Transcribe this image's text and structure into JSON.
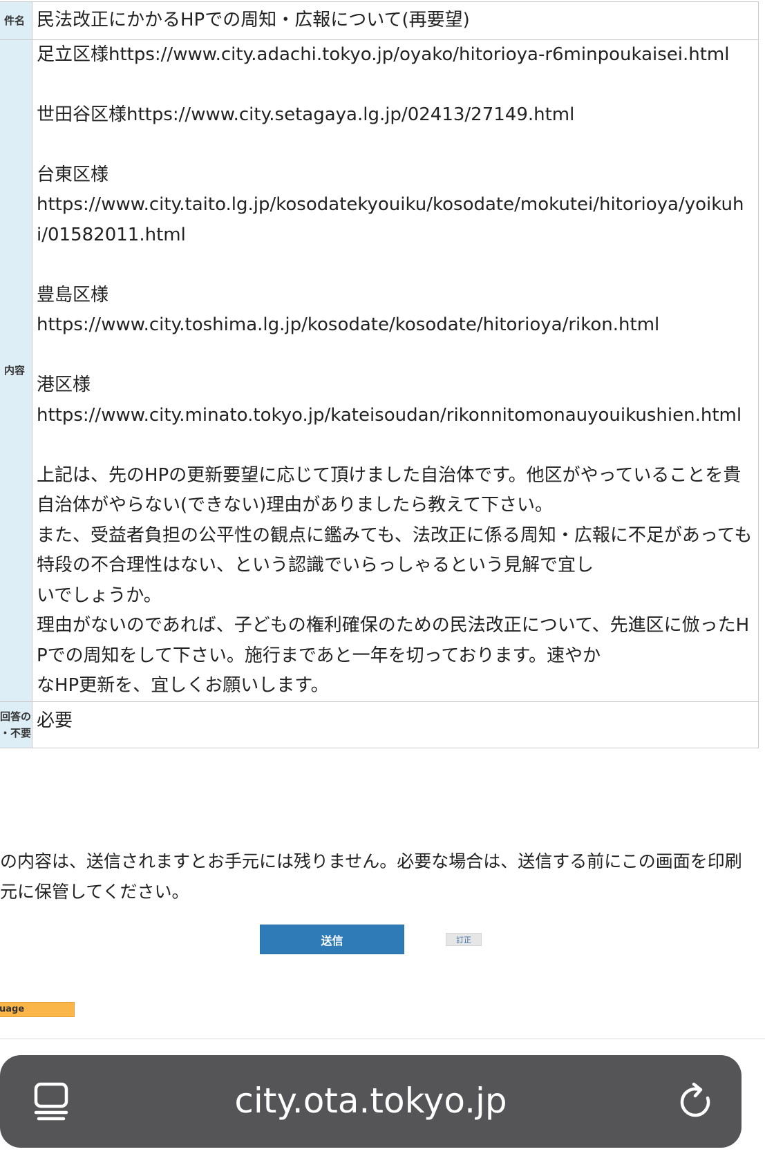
{
  "form": {
    "subject": {
      "label": "件名",
      "value": "民法改正にかかるHPでの周知・広報について(再要望)"
    },
    "content": {
      "label": "内容",
      "paragraphs": [
        "足立区様https://www.city.adachi.tokyo.jp/oyako/hitorioya-r6minpoukaisei.html",
        "",
        "世田谷区様https://www.city.setagaya.lg.jp/02413/27149.html",
        "",
        "台東区様",
        "https://www.city.taito.lg.jp/kosodatekyouiku/kosodate/mokutei/hitorioya/yoikuhi/01582011.html",
        "",
        "豊島区様",
        "https://www.city.toshima.lg.jp/kosodate/kosodate/hitorioya/rikon.html",
        "",
        "港区様",
        "https://www.city.minato.tokyo.jp/kateisoudan/rikonnitomonauyouikushien.html",
        "",
        "上記は、先のHPの更新要望に応じて頂けました自治体です。他区がやっていることを貴自治体がやらない(できない)理由がありましたら教えて下さい。",
        "また、受益者負担の公平性の観点に鑑みても、法改正に係る周知・広報に不足があっても特段の不合理性はない、という認識でいらっしゃるという見解で宜し",
        "いでしょうか。",
        "理由がないのであれば、子どもの権利確保のための民法改正について、先進区に倣ったHPでの周知をして下さい。施行まであと一年を切っております。速やか",
        "なHP更新を、宜しくお願いします。"
      ]
    },
    "reply": {
      "label_line1": "回答の",
      "label_line2": "・不要",
      "value": "必要"
    }
  },
  "notice": {
    "line1": "の内容は、送信されますとお手元には残りません。必要な場合は、送信する前にこの画面を印刷",
    "line2": "元に保管してください。"
  },
  "buttons": {
    "send_label": "送信",
    "fix_label": "訂正"
  },
  "language_label": "uage",
  "browser": {
    "url": "city.ota.tokyo.jp",
    "tabs_icon": "tab-overview-icon",
    "reload_icon": "reload-icon"
  },
  "colors": {
    "header_bg": "#ddeef6",
    "send_button": "#2e7bb8",
    "language_bar": "#fbb64a",
    "url_bar": "#555557"
  }
}
